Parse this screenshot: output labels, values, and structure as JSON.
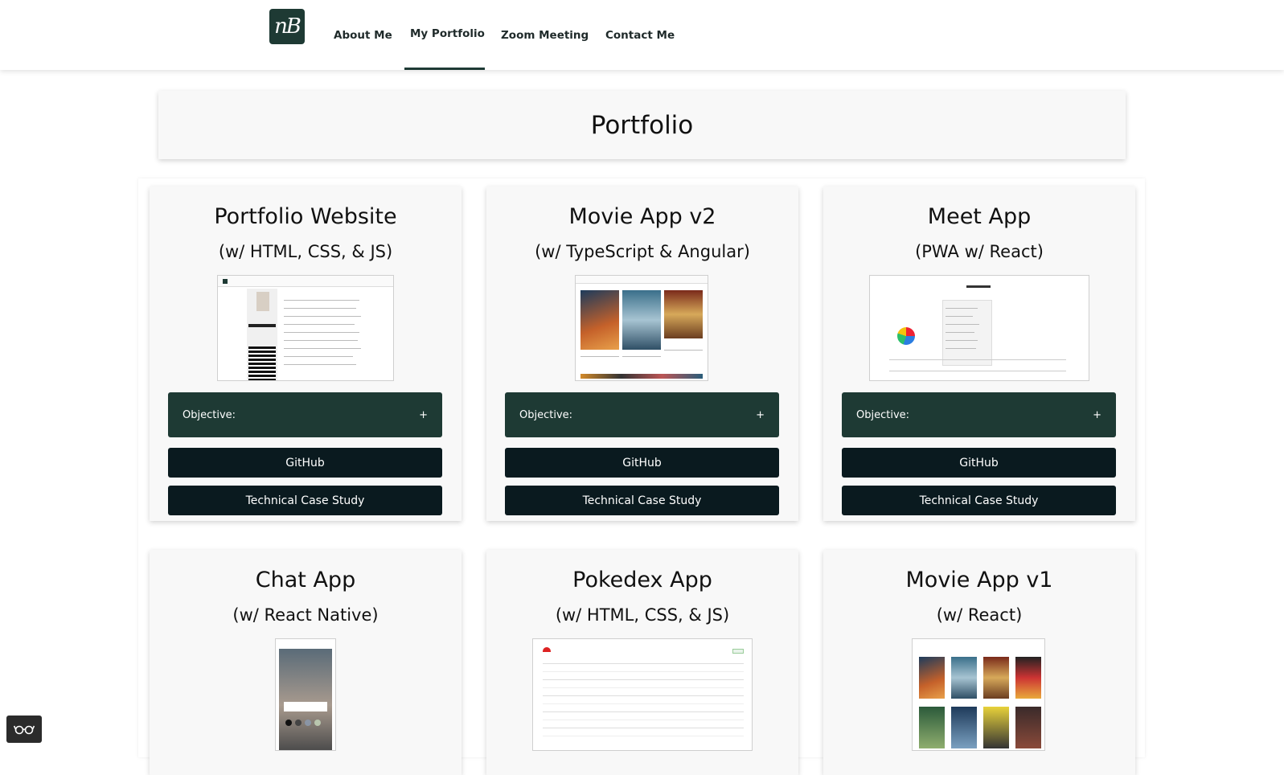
{
  "nav": {
    "logo_text": "nB",
    "items": [
      "About Me",
      "My Portfolio",
      "Zoom Meeting",
      "Contact Me"
    ],
    "active": "My Portfolio"
  },
  "page": {
    "title": "Portfolio"
  },
  "cards": [
    {
      "title": "Portfolio Website",
      "subtitle": "(w/ HTML, CSS, & JS)",
      "objective_label": "Objective:",
      "toggle": "+",
      "github_label": "GitHub",
      "case_study_label": "Technical Case Study"
    },
    {
      "title": "Movie App v2",
      "subtitle": "(w/ TypeScript & Angular)",
      "objective_label": "Objective:",
      "toggle": "+",
      "github_label": "GitHub",
      "case_study_label": "Technical Case Study"
    },
    {
      "title": "Meet App",
      "subtitle": "(PWA w/ React)",
      "objective_label": "Objective:",
      "toggle": "+",
      "github_label": "GitHub",
      "case_study_label": "Technical Case Study"
    },
    {
      "title": "Chat App",
      "subtitle": "(w/ React Native)"
    },
    {
      "title": "Pokedex App",
      "subtitle": "(w/ HTML, CSS, & JS)"
    },
    {
      "title": "Movie App v1",
      "subtitle": "(w/ React)"
    }
  ],
  "colors": {
    "accent": "#1e3a34",
    "button": "#0a1a1f",
    "card_bg": "#f8f8f8"
  },
  "icons": {
    "accessibility": "glasses-icon"
  }
}
